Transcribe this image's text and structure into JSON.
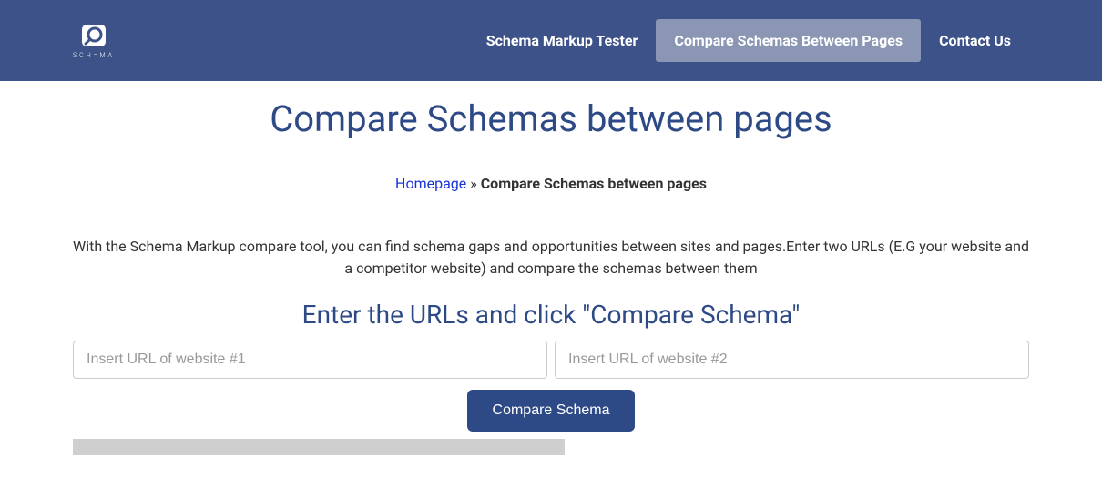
{
  "logo": {
    "text": "SCH=MA"
  },
  "nav": {
    "items": [
      {
        "label": "Schema Markup Tester",
        "active": false
      },
      {
        "label": "Compare Schemas Between Pages",
        "active": true
      },
      {
        "label": "Contact Us",
        "active": false
      }
    ]
  },
  "page_title": "Compare Schemas between pages",
  "breadcrumb": {
    "home_label": "Homepage",
    "separator": " » ",
    "current": "Compare Schemas between pages"
  },
  "description": "With the Schema Markup compare tool, you can find schema gaps and opportunities between sites and pages.Enter two URLs (E.G your website and a competitor website) and compare the schemas between them",
  "form": {
    "heading": "Enter the URLs and click \"Compare Schema\"",
    "url1_placeholder": "Insert URL of website #1",
    "url2_placeholder": "Insert URL of website #2",
    "button_label": "Compare Schema"
  }
}
